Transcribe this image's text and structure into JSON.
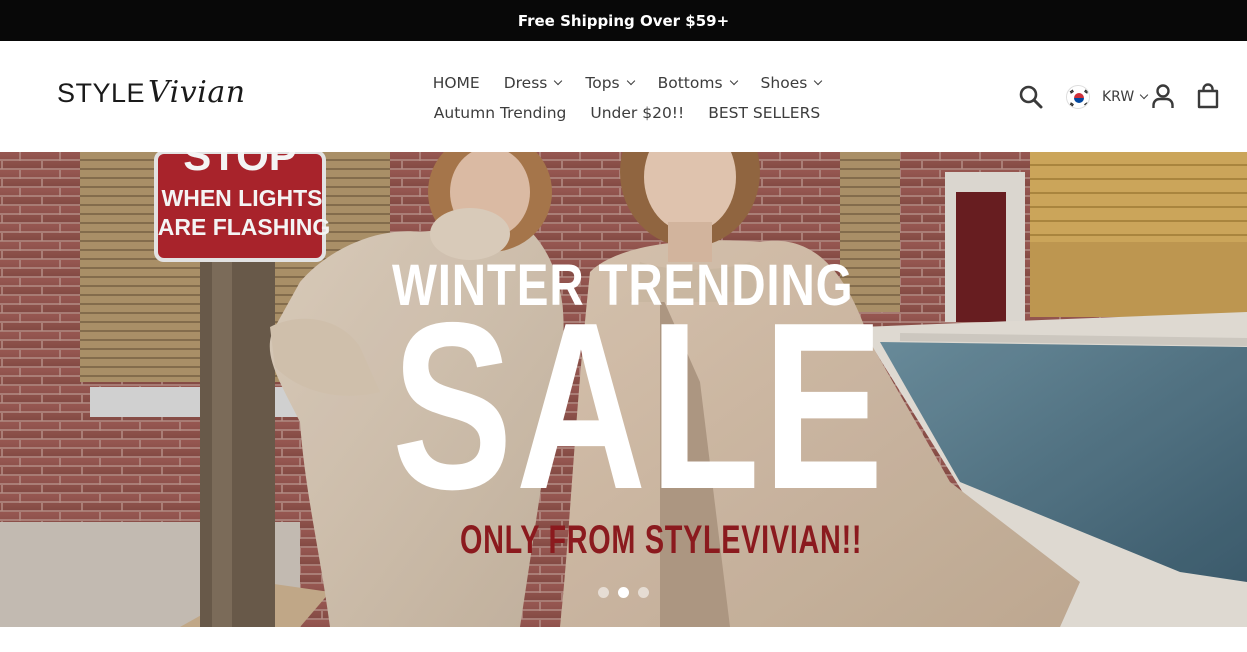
{
  "announcement": {
    "text": "Free Shipping Over $59+"
  },
  "logo": {
    "part1": "STYLE",
    "part2": "Vivian"
  },
  "nav": {
    "row1": [
      {
        "label": "HOME",
        "dropdown": false
      },
      {
        "label": "Dress",
        "dropdown": true
      },
      {
        "label": "Tops",
        "dropdown": true
      },
      {
        "label": "Bottoms",
        "dropdown": true
      },
      {
        "label": "Shoes",
        "dropdown": true
      }
    ],
    "row2": [
      {
        "label": "Autumn Trending",
        "dropdown": false
      },
      {
        "label": "Under $20!!",
        "dropdown": false
      },
      {
        "label": "BEST SELLERS",
        "dropdown": false
      }
    ]
  },
  "tools": {
    "search_icon": "search-icon",
    "currency_code": "KRW",
    "currency_flag": "south-korea-flag-icon",
    "account_icon": "user-icon",
    "cart_icon": "shopping-bag-icon"
  },
  "hero": {
    "headline": "WINTER TRENDING",
    "big_text": "SALE",
    "subtext": "ONLY FROM STYLEVIVIAN!!",
    "sign_line1": "STOP",
    "sign_line2": "WHEN LIGHTS",
    "sign_line3": "ARE FLASHING",
    "slides": 3,
    "active_slide": 2
  },
  "colors": {
    "announcement_bg": "#080808",
    "subtext": "#8b1a1e",
    "sign_red": "#b3262e"
  }
}
